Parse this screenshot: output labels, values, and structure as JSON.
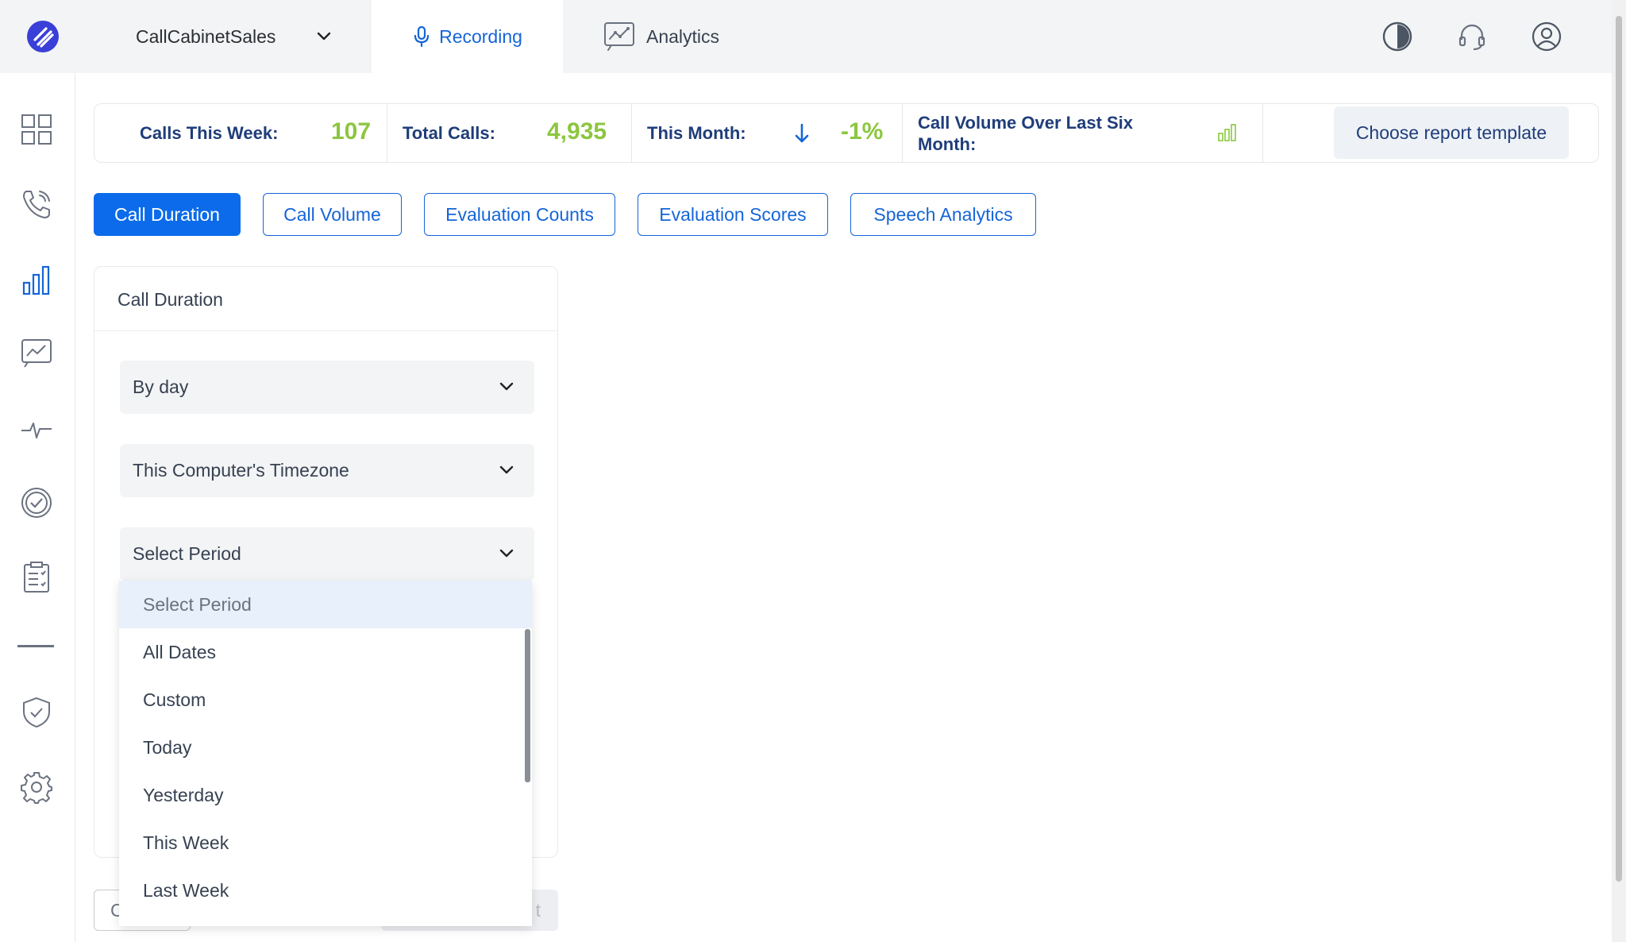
{
  "header": {
    "account_name": "CallCabinetSales",
    "tabs": {
      "recording": "Recording",
      "analytics": "Analytics"
    }
  },
  "stats": {
    "calls_this_week_label": "Calls This Week:",
    "calls_this_week_value": "107",
    "total_calls_label": "Total Calls:",
    "total_calls_value": "4,935",
    "this_month_label": "This Month:",
    "this_month_value": "-1%",
    "volume_label_line1": "Call Volume Over Last Six",
    "volume_label_line2": "Month:"
  },
  "report_template_button": "Choose report template",
  "report_tabs": [
    "Call Duration",
    "Call Volume",
    "Evaluation Counts",
    "Evaluation Scores",
    "Speech Analytics"
  ],
  "card": {
    "title": "Call Duration",
    "group_select": "By day",
    "timezone_select": "This Computer's Timezone",
    "period_select": "Select Period"
  },
  "period_options": [
    "Select Period",
    "All Dates",
    "Custom",
    "Today",
    "Yesterday",
    "This Week",
    "Last Week"
  ],
  "bottom_buttons": {
    "left_partial": "C",
    "right_partial": "t"
  },
  "colors": {
    "primary": "#0b6bea",
    "accent_green": "#8cc63f",
    "navy": "#1f3d7a"
  }
}
